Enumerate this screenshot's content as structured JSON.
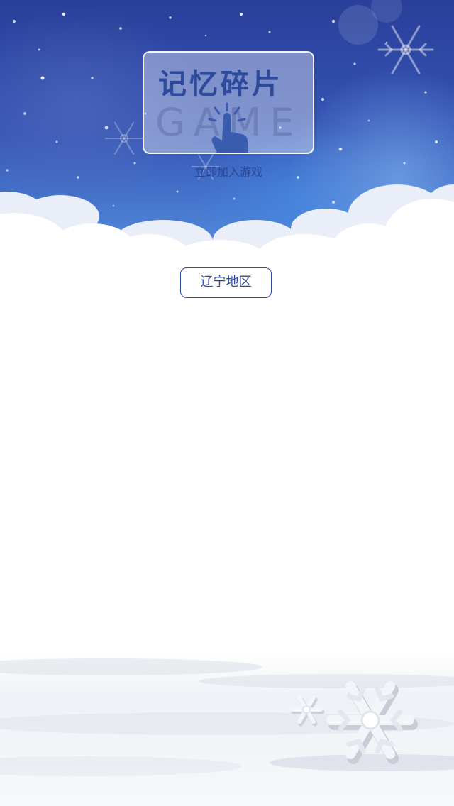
{
  "header": {
    "title": "记忆碎片",
    "watermark_word": "GAME",
    "subtitle": "立即加入游戏"
  },
  "region_selector": {
    "label": "辽宁地区"
  },
  "colors": {
    "sky_top": "#2a3f9a",
    "sky_bottom": "#6aa0e6",
    "accent": "#2e4a9c",
    "cloud": "#ffffff",
    "background": "#ffffff"
  },
  "icons": {
    "tap": "tap-hand-icon",
    "snowflake": "snowflake-icon"
  }
}
